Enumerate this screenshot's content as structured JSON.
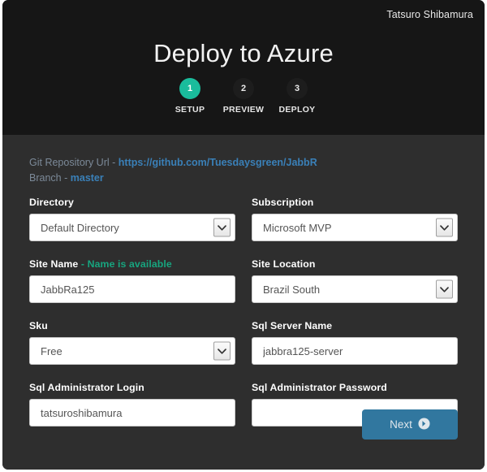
{
  "header": {
    "user_name": "Tatsuro Shibamura",
    "title": "Deploy to Azure",
    "steps": [
      {
        "number": "1",
        "label": "SETUP",
        "active": true
      },
      {
        "number": "2",
        "label": "PREVIEW",
        "active": false
      },
      {
        "number": "3",
        "label": "DEPLOY",
        "active": false
      }
    ]
  },
  "repo": {
    "url_label": "Git Repository Url",
    "separator": "-",
    "url_value": "https://github.com/Tuesdaysgreen/JabbR",
    "branch_label": "Branch",
    "branch_value": "master"
  },
  "form": {
    "directory": {
      "label": "Directory",
      "value": "Default Directory",
      "type": "select"
    },
    "subscription": {
      "label": "Subscription",
      "value": "Microsoft MVP",
      "type": "select"
    },
    "site_name": {
      "label": "Site Name",
      "note": "- Name is available",
      "value": "JabbRa125",
      "placeholder": "",
      "type": "text"
    },
    "site_location": {
      "label": "Site Location",
      "value": "Brazil South",
      "type": "select"
    },
    "sku": {
      "label": "Sku",
      "value": "Free",
      "type": "select"
    },
    "sql_server_name": {
      "label": "Sql Server Name",
      "value": "jabbra125-server",
      "placeholder": "",
      "type": "text"
    },
    "sql_admin_login": {
      "label": "Sql Administrator Login",
      "value": "tatsuroshibamura",
      "placeholder": "",
      "type": "text"
    },
    "sql_admin_password": {
      "label": "Sql Administrator Password",
      "value": "",
      "placeholder": "",
      "type": "password"
    }
  },
  "actions": {
    "next_label": "Next",
    "next_icon": "arrow-circle-right-icon"
  },
  "colors": {
    "header_bg": "#161616",
    "body_bg": "#2e2e2e",
    "accent_green": "#1abc9c",
    "note_green": "#17a57f",
    "link_blue": "#3a80b8",
    "button_blue": "#31779f"
  }
}
